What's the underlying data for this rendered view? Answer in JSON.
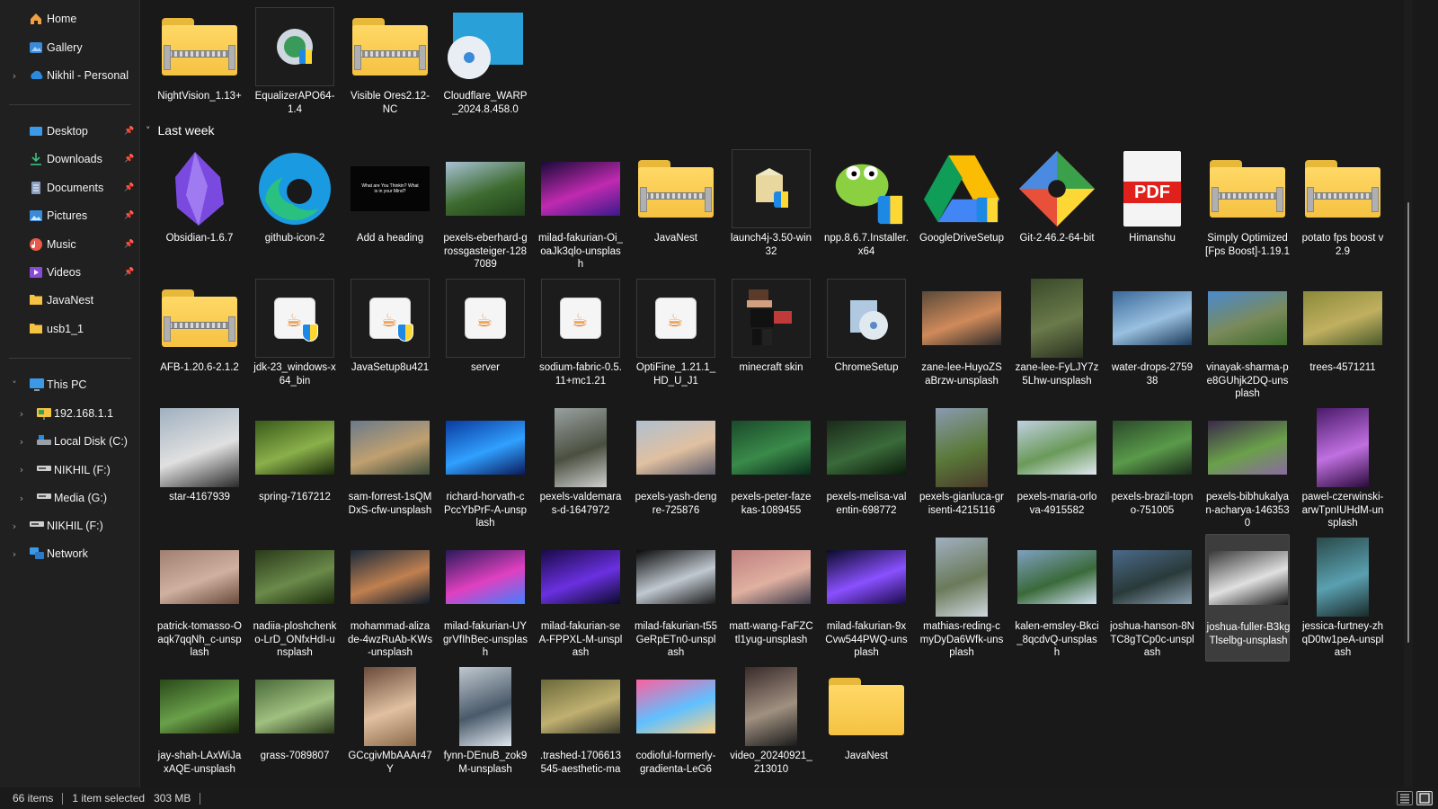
{
  "sidebar": {
    "top": [
      {
        "label": "Home",
        "icon": "home-icon",
        "chevron": false
      },
      {
        "label": "Gallery",
        "icon": "gallery-icon",
        "chevron": false
      },
      {
        "label": "Nikhil - Personal",
        "icon": "onedrive-icon",
        "chevron": true
      }
    ],
    "quick_access": [
      {
        "label": "Desktop",
        "icon": "desktop-icon",
        "pinned": true
      },
      {
        "label": "Downloads",
        "icon": "download-icon",
        "pinned": true
      },
      {
        "label": "Documents",
        "icon": "documents-icon",
        "pinned": true
      },
      {
        "label": "Pictures",
        "icon": "pictures-icon",
        "pinned": true
      },
      {
        "label": "Music",
        "icon": "music-icon",
        "pinned": true
      },
      {
        "label": "Videos",
        "icon": "videos-icon",
        "pinned": true
      },
      {
        "label": "JavaNest",
        "icon": "folder-icon",
        "pinned": false
      },
      {
        "label": "usb1_1",
        "icon": "folder-icon",
        "pinned": false
      }
    ],
    "this_pc": {
      "label": "This PC",
      "icon": "pc-icon",
      "expanded": true
    },
    "drives": [
      {
        "label": "192.168.1.1",
        "icon": "network-drive-icon"
      },
      {
        "label": "Local Disk (C:)",
        "icon": "local-disk-icon"
      },
      {
        "label": "NIKHIL (F:)",
        "icon": "usb-drive-icon"
      },
      {
        "label": "Media (G:)",
        "icon": "usb-drive-icon"
      }
    ],
    "bottom": [
      {
        "label": "NIKHIL (F:)",
        "icon": "usb-drive-icon"
      },
      {
        "label": "Network",
        "icon": "network-icon"
      }
    ]
  },
  "group_header": {
    "label": "Last week",
    "chevron": "˅"
  },
  "files_top": [
    {
      "name": "NightVision_1.13+",
      "kind": "zip-folder"
    },
    {
      "name": "EqualizerAPO64-1.4",
      "kind": "installer-eq"
    },
    {
      "name": "Visible Ores2.12-NC",
      "kind": "zip-folder"
    },
    {
      "name": "Cloudflare_WARP_2024.8.458.0",
      "kind": "disc-installer"
    }
  ],
  "files": [
    {
      "name": "Obsidian-1.6.7",
      "kind": "obsidian"
    },
    {
      "name": "github-icon-2",
      "kind": "edge"
    },
    {
      "name": "Add a heading",
      "kind": "dark-image",
      "caption": "What are You Thinkin? What is in your Mind?"
    },
    {
      "name": "pexels-eberhard-grossgasteiger-1287089",
      "kind": "photo",
      "colors": [
        "#a8c2d6",
        "#3d6b2f",
        "#1f3f1a"
      ]
    },
    {
      "name": "milad-fakurian-Oi_oaJk3qlo-unsplash",
      "kind": "photo",
      "colors": [
        "#1a0a3a",
        "#c02ab0",
        "#3a1a8a"
      ]
    },
    {
      "name": "JavaNest",
      "kind": "zip-folder"
    },
    {
      "name": "launch4j-3.50-win32",
      "kind": "installer-box"
    },
    {
      "name": "npp.8.6.7.Installer.x64",
      "kind": "npp"
    },
    {
      "name": "GoogleDriveSetup",
      "kind": "gdrive"
    },
    {
      "name": "Git-2.46.2-64-bit",
      "kind": "git"
    },
    {
      "name": "Himanshu",
      "kind": "pdf",
      "pdf_label": "PDF"
    },
    {
      "name": "Simply Optimized [Fps Boost]-1.19.1",
      "kind": "zip-folder"
    },
    {
      "name": "potato fps boost v 2.9",
      "kind": "zip-folder"
    },
    {
      "name": "AFB-1.20.6-2.1.2",
      "kind": "zip-folder"
    },
    {
      "name": "jdk-23_windows-x64_bin",
      "kind": "java"
    },
    {
      "name": "JavaSetup8u421",
      "kind": "java"
    },
    {
      "name": "server",
      "kind": "java-plain"
    },
    {
      "name": "sodium-fabric-0.5.11+mc1.21",
      "kind": "java-plain"
    },
    {
      "name": "OptiFine_1.21.1_HD_U_J1",
      "kind": "java-plain"
    },
    {
      "name": "minecraft skin",
      "kind": "skin"
    },
    {
      "name": "ChromeSetup",
      "kind": "installer-disc"
    },
    {
      "name": "zane-lee-HuyoZSaBrzw-unsplash",
      "kind": "photo",
      "colors": [
        "#5a4a3a",
        "#d08a5a",
        "#2a2a2a"
      ]
    },
    {
      "name": "zane-lee-FyLJY7z5Lhw-unsplash",
      "kind": "photo-tall",
      "colors": [
        "#3a4a2a",
        "#6a7a4a",
        "#2a3020"
      ]
    },
    {
      "name": "water-drops-275938",
      "kind": "photo",
      "colors": [
        "#3a6a9a",
        "#9ac0e0",
        "#1a3a5a"
      ]
    },
    {
      "name": "vinayak-sharma-pe8GUhjk2DQ-unsplash",
      "kind": "photo",
      "colors": [
        "#4a8ad0",
        "#7a8a5a",
        "#3a6a2a"
      ]
    },
    {
      "name": "trees-4571211",
      "kind": "photo",
      "colors": [
        "#8a8a3a",
        "#c0b060",
        "#4a5a2a"
      ]
    },
    {
      "name": "star-4167939",
      "kind": "photo-square",
      "colors": [
        "#a0b0c0",
        "#e0e0e0",
        "#2a2a2a"
      ]
    },
    {
      "name": "spring-7167212",
      "kind": "photo",
      "colors": [
        "#3a5a1a",
        "#8ab04a",
        "#1a2a0a"
      ]
    },
    {
      "name": "sam-forrest-1sQMDxS-cfw-unsplash",
      "kind": "photo",
      "colors": [
        "#6a7a8a",
        "#c0a070",
        "#3a4a3a"
      ]
    },
    {
      "name": "richard-horvath-cPccYbPrF-A-unsplash",
      "kind": "photo",
      "colors": [
        "#0a3aa0",
        "#30a0ff",
        "#0a1a5a"
      ]
    },
    {
      "name": "pexels-valdemaras-d-1647972",
      "kind": "photo-tall",
      "colors": [
        "#9aa0a0",
        "#4a5040",
        "#d0d0d0"
      ]
    },
    {
      "name": "pexels-yash-dengre-725876",
      "kind": "photo",
      "colors": [
        "#b0c0d0",
        "#e0c0a0",
        "#5a5a6a"
      ]
    },
    {
      "name": "pexels-peter-fazekas-1089455",
      "kind": "photo",
      "colors": [
        "#1a4a2a",
        "#3a8a4a",
        "#0a2a1a"
      ]
    },
    {
      "name": "pexels-melisa-valentin-698772",
      "kind": "photo",
      "colors": [
        "#1a2a1a",
        "#3a6a3a",
        "#0a1a0a"
      ]
    },
    {
      "name": "pexels-gianluca-grisenti-4215116",
      "kind": "photo-tall",
      "colors": [
        "#8a9ab0",
        "#5a7a3a",
        "#4a3a2a"
      ]
    },
    {
      "name": "pexels-maria-orlova-4915582",
      "kind": "photo",
      "colors": [
        "#c0d0e0",
        "#6a9a5a",
        "#e0e8f0"
      ]
    },
    {
      "name": "pexels-brazil-topno-751005",
      "kind": "photo",
      "colors": [
        "#2a4a2a",
        "#5a9a4a",
        "#1a2a1a"
      ]
    },
    {
      "name": "pexels-bibhukalyan-acharya-1463530",
      "kind": "photo",
      "colors": [
        "#3a2a4a",
        "#6aa04a",
        "#8a6aa0"
      ]
    },
    {
      "name": "pawel-czerwinski-arwTpnIUHdM-unsplash",
      "kind": "photo-tall",
      "colors": [
        "#4a1a6a",
        "#c070e0",
        "#2a0a3a"
      ]
    },
    {
      "name": "patrick-tomasso-Oaqk7qqNh_c-unsplash",
      "kind": "photo",
      "colors": [
        "#a08070",
        "#d0b0a0",
        "#6a4a3a"
      ]
    },
    {
      "name": "nadiia-ploshchenko-LrD_ONfxHdI-unsplash",
      "kind": "photo",
      "colors": [
        "#2a3a1a",
        "#6a8a4a",
        "#1a2a0a"
      ]
    },
    {
      "name": "mohammad-alizade-4wzRuAb-KWs-unsplash",
      "kind": "photo",
      "colors": [
        "#1a2a3a",
        "#c08050",
        "#0a1a2a"
      ]
    },
    {
      "name": "milad-fakurian-UYgrVfIhBec-unsplash",
      "kind": "photo",
      "colors": [
        "#2a1a5a",
        "#e040c0",
        "#4080ff"
      ]
    },
    {
      "name": "milad-fakurian-seA-FPPXL-M-unsplash",
      "kind": "photo",
      "colors": [
        "#1a0a4a",
        "#6a30e0",
        "#0a0a2a"
      ]
    },
    {
      "name": "milad-fakurian-t55GeRpETn0-unsplash",
      "kind": "photo",
      "colors": [
        "#0a0a0a",
        "#c0c8d0",
        "#1a1a1a"
      ]
    },
    {
      "name": "matt-wang-FaFZCtl1yug-unsplash",
      "kind": "photo",
      "colors": [
        "#c08080",
        "#e0b0a0",
        "#3a3a4a"
      ]
    },
    {
      "name": "milad-fakurian-9xCvw544PWQ-unsplash",
      "kind": "photo",
      "colors": [
        "#0a0a2a",
        "#8a50ff",
        "#1a0a4a"
      ]
    },
    {
      "name": "mathias-reding-cmyDyDa6Wfk-unsplash",
      "kind": "photo-tall",
      "colors": [
        "#a0b0c0",
        "#6a7a5a",
        "#d0d8e0"
      ]
    },
    {
      "name": "kalen-emsley-Bkci_8qcdvQ-unsplash",
      "kind": "photo",
      "colors": [
        "#80a0c0",
        "#3a6a3a",
        "#d0e0f0"
      ]
    },
    {
      "name": "joshua-hanson-8NTC8gTCp0c-unsplash",
      "kind": "photo",
      "colors": [
        "#4a6a8a",
        "#2a3a3a",
        "#8aa0b0"
      ]
    },
    {
      "name": "joshua-fuller-B3kgTlselbg-unsplash",
      "kind": "photo",
      "colors": [
        "#3a3a3a",
        "#e0e0e0",
        "#1a1a1a"
      ],
      "selected": true
    },
    {
      "name": "jessica-furtney-zhqD0tw1peA-unsplash",
      "kind": "photo-tall",
      "colors": [
        "#2a4a4a",
        "#5aa0b0",
        "#1a2a2a"
      ]
    },
    {
      "name": "jay-shah-LAxWiJaxAQE-unsplash",
      "kind": "photo",
      "colors": [
        "#2a4a1a",
        "#6aa04a",
        "#1a2a0a"
      ]
    },
    {
      "name": "grass-7089807",
      "kind": "photo",
      "colors": [
        "#4a6a3a",
        "#a0c080",
        "#2a3a1a"
      ]
    },
    {
      "name": "GCcgivMbAAAr47Y",
      "kind": "photo-tall",
      "colors": [
        "#6a4a3a",
        "#e0c0a0",
        "#8a6a4a"
      ]
    },
    {
      "name": "fynn-DEnuB_zok9M-unsplash",
      "kind": "photo-tall",
      "colors": [
        "#c0c8d0",
        "#4a5a6a",
        "#e0e8f0"
      ]
    },
    {
      "name": ".trashed-1706613545-aesthetic-ma",
      "kind": "photo",
      "colors": [
        "#6a6a3a",
        "#c0b070",
        "#3a3a2a"
      ]
    },
    {
      "name": "codioful-formerly-gradienta-LeG6",
      "kind": "photo",
      "colors": [
        "#ff60a0",
        "#60c0ff",
        "#ffd080"
      ]
    },
    {
      "name": "video_20240921_213010",
      "kind": "photo-tall",
      "colors": [
        "#3a2a2a",
        "#a09080",
        "#1a1a1a"
      ]
    },
    {
      "name": "JavaNest",
      "kind": "folder"
    }
  ],
  "status": {
    "items": "66 items",
    "selected": "1 item selected",
    "size": "303 MB"
  }
}
